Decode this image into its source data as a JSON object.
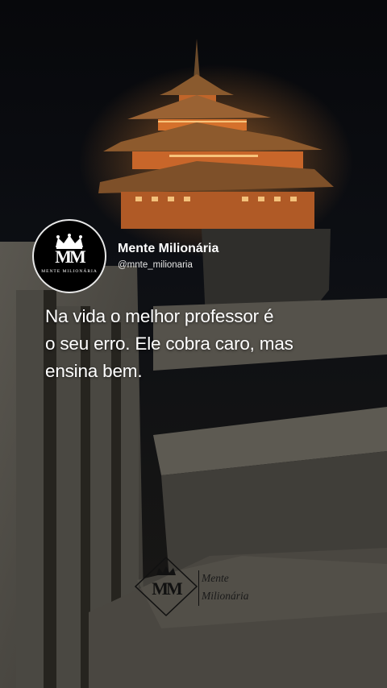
{
  "profile": {
    "display_name": "Mente Milionária",
    "handle": "@mnte_milionaria",
    "avatar_monogram": "MM",
    "avatar_subtitle": "MENTE MILIONÁRIA"
  },
  "post": {
    "text": "Na vida o melhor professor é\no seu erro. Ele cobra caro, mas\nensina bem."
  },
  "watermark": {
    "monogram": "MM",
    "line1": "Mente",
    "line2": "Milionária"
  },
  "colors": {
    "text": "#ffffff",
    "background": "#0a0a0c",
    "pavilion_glow": "#e0762a"
  }
}
